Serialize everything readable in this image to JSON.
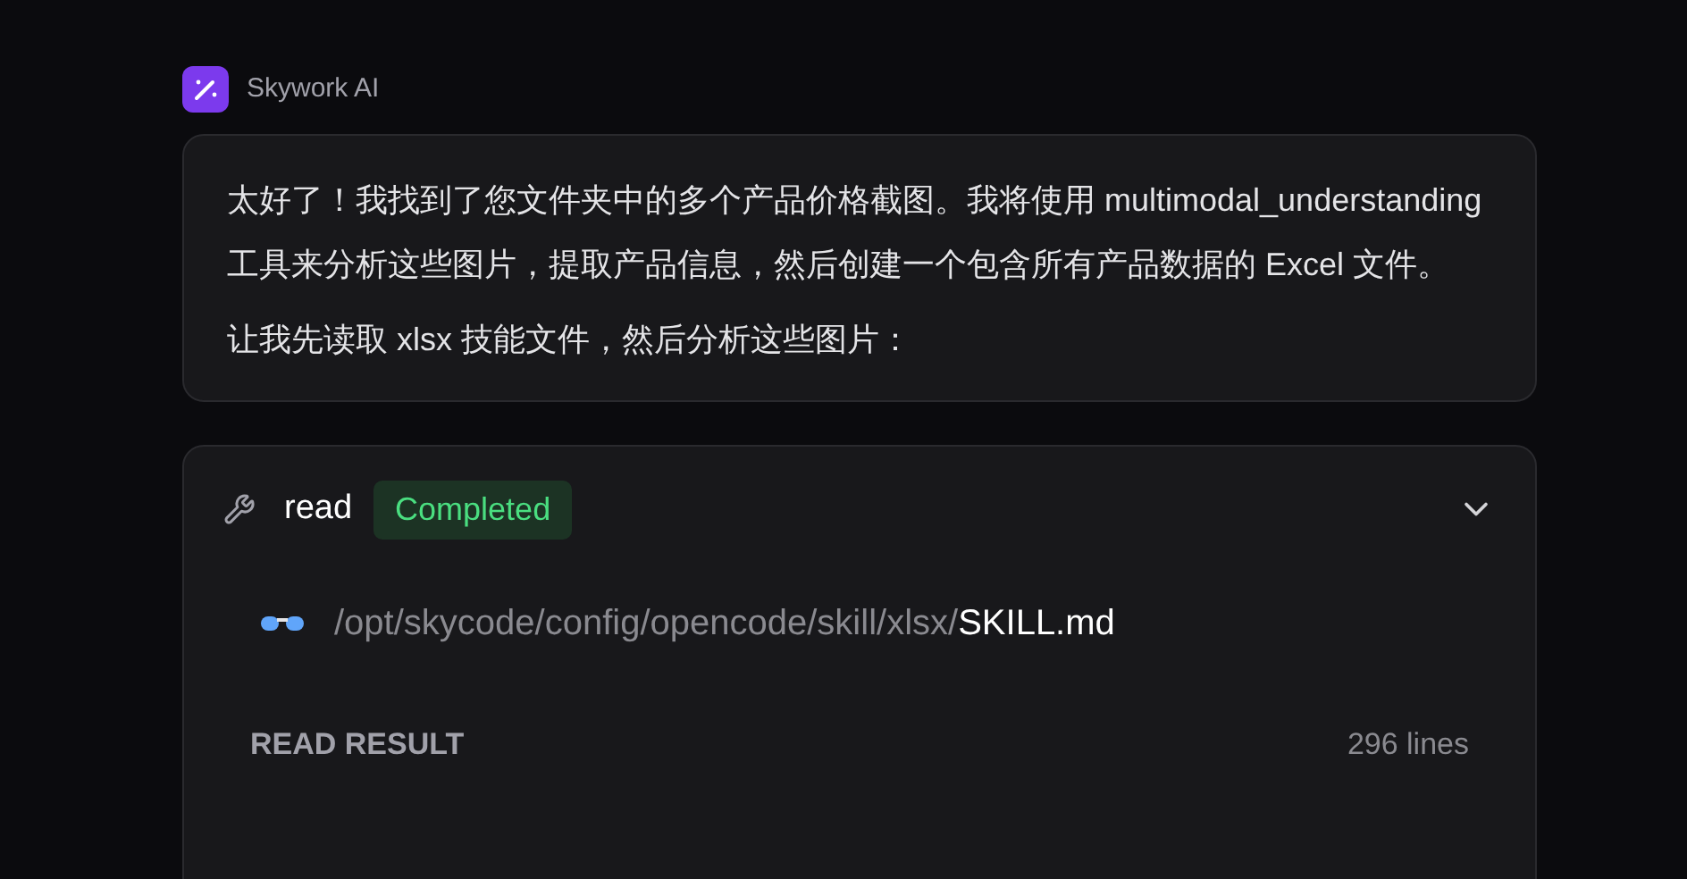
{
  "assistant": {
    "name": "Skywork AI"
  },
  "message": {
    "paragraphs": [
      "太好了！我找到了您文件夹中的多个产品价格截图。我将使用 multimodal_understanding 工具来分析这些图片，提取产品信息，然后创建一个包含所有产品数据的 Excel 文件。",
      "让我先读取 xlsx 技能文件，然后分析这些图片："
    ]
  },
  "tool_call": {
    "name": "read",
    "status": {
      "label": "Completed",
      "kind": "success"
    },
    "expanded": true,
    "path_dir": "/opt/skycode/config/opencode/skill/xlsx/",
    "path_file": "SKILL.md",
    "result_label": "READ RESULT",
    "result_count": "296 lines"
  }
}
